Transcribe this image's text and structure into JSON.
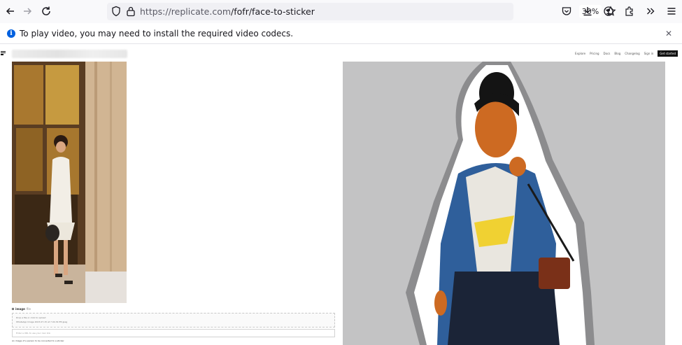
{
  "browser": {
    "url_domain": "https://replicate.com",
    "url_path": "/fofr/face-to-sticker",
    "zoom": "30%"
  },
  "notification": {
    "message": "To play video, you may need to install the required video codecs."
  },
  "site": {
    "nav": [
      "Explore",
      "Pricing",
      "Docs",
      "Blog",
      "Changelog",
      "Sign in"
    ],
    "cta": "Get started"
  },
  "form": {
    "input_label": "image",
    "input_tag": "file",
    "drop_hint": "Drop a file or click to upload",
    "file_name": "WhatsApp Image 2023-07-15 at 7.04.34 PM.jpeg",
    "url_placeholder": "Enter a URL to use your own link",
    "helper": "An image of a person to be converted to a sticker"
  },
  "colors": {
    "accent": "#0060df",
    "sticker_bg": "#c3c3c4"
  }
}
